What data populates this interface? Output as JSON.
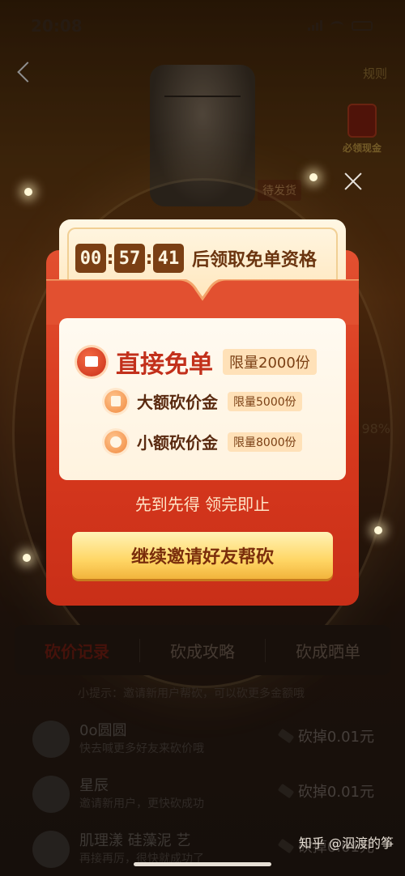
{
  "status_bar": {
    "time": "20:08"
  },
  "header": {
    "rules_link": "规则"
  },
  "background": {
    "cash_button_label": "必领现金",
    "pending_tag": "待发货",
    "progress_percent": "98%",
    "tabs": [
      {
        "label": "砍价记录"
      },
      {
        "label": "砍成攻略"
      },
      {
        "label": "砍成晒单"
      }
    ],
    "tip": "小提示：邀请新用户帮砍，可以砍更多金额哦",
    "bargain_records": [
      {
        "name": "0o圆圆",
        "desc": "快去喊更多好友来砍价哦",
        "amount": "砍掉0.01元"
      },
      {
        "name": "星辰",
        "desc": "邀请新用户，更快砍成功",
        "amount": "砍掉0.01元"
      },
      {
        "name": "肌理漾 硅藻泥 艺",
        "desc": "再接再厉，很快就成功了",
        "amount": "砍掉0.01元"
      }
    ]
  },
  "modal": {
    "countdown": {
      "hours": "00",
      "minutes": "57",
      "seconds": "41",
      "suffix": "后领取免单资格"
    },
    "prizes": {
      "main": {
        "title": "直接免单",
        "limit": "限量2000份"
      },
      "big": {
        "title": "大额砍价金",
        "limit": "限量5000份"
      },
      "small": {
        "title": "小额砍价金",
        "limit": "限量8000份"
      }
    },
    "first_come": "先到先得 领完即止",
    "invite_button": "继续邀请好友帮砍"
  },
  "watermark": "知乎 @泅渡的筝",
  "colors": {
    "envelope_red": "#d8391e",
    "accent_gold": "#ffd665",
    "countdown_digit_bg": "#7a3f14"
  }
}
